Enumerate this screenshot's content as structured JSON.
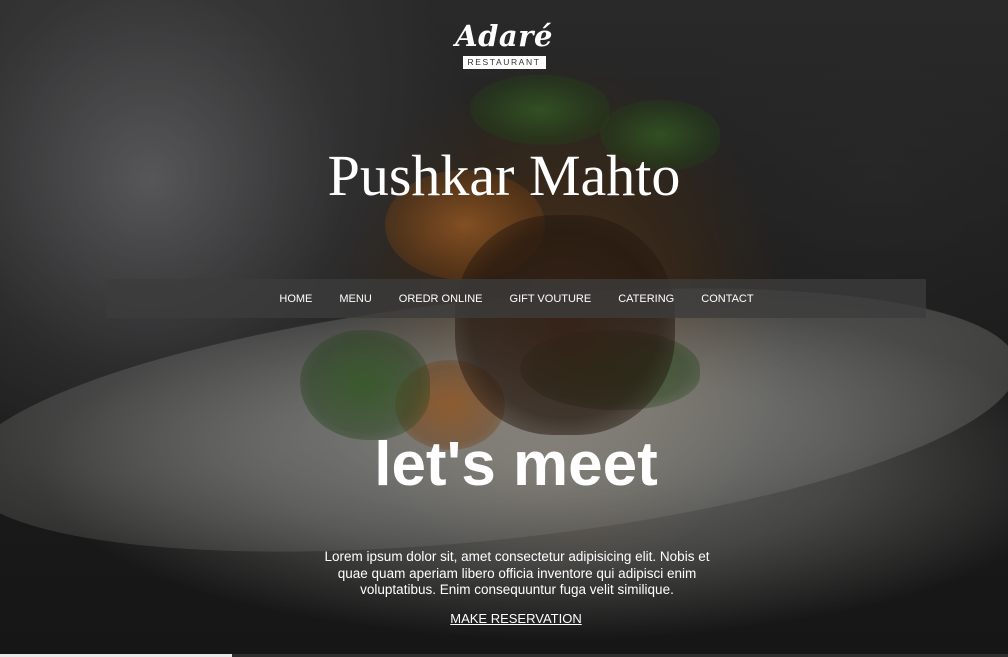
{
  "brand": {
    "logo_word": "Adaré",
    "logo_sub": "RESTAURANT"
  },
  "site_title": "Pushkar Mahto",
  "nav": {
    "items": [
      {
        "label": "HOME"
      },
      {
        "label": "MENU"
      },
      {
        "label": "OREDR ONLINE"
      },
      {
        "label": "GIFT VOUTURE"
      },
      {
        "label": "CATERING"
      },
      {
        "label": "CONTACT"
      }
    ]
  },
  "hero": {
    "headline": "let's meet",
    "intro": "Lorem ipsum dolor sit, amet consectetur adipisicing elit. Nobis et quae quam aperiam libero officia inventore qui adipisci enim voluptatibus. Enim consequuntur fuga velit similique.",
    "cta_label": "MAKE RESERVATION"
  },
  "colors": {
    "text": "#ffffff",
    "navbar_bg": "#3c3c3c",
    "logo_badge_bg": "#ffffff"
  }
}
